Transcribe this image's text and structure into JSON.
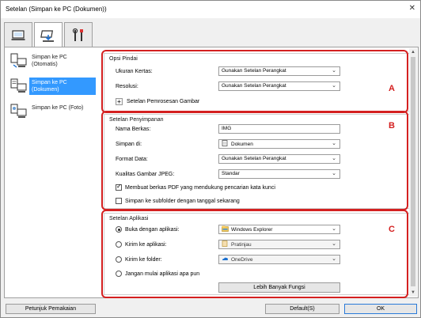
{
  "window": {
    "title": "Setelan (Simpan ke PC (Dokumen))",
    "close_glyph": "✕"
  },
  "tabs": [
    {
      "icon": "scan-to-pc-icon",
      "active": false
    },
    {
      "icon": "scanner-icon",
      "active": true
    },
    {
      "icon": "tools-icon",
      "active": false
    }
  ],
  "sidebar": {
    "items": [
      {
        "label": "Simpan ke PC (Otomatis)",
        "icon": "pc-auto-icon",
        "selected": false
      },
      {
        "label": "Simpan ke PC (Dokumen)",
        "icon": "pc-document-icon",
        "selected": true
      },
      {
        "label": "Simpan ke PC (Foto)",
        "icon": "pc-photo-icon",
        "selected": false
      }
    ]
  },
  "scan_options": {
    "header": "Opsi Pindai",
    "paper_size_label": "Ukuran Kertas:",
    "paper_size_value": "Gunakan Setelan Perangkat",
    "resolution_label": "Resolusi:",
    "resolution_value": "Gunakan Setelan Perangkat",
    "image_processing_label": "Setelan Pemrosesan Gambar",
    "marker": "A"
  },
  "save_settings": {
    "header": "Setelan Penyimpanan",
    "file_name_label": "Nama Berkas:",
    "file_name_value": "IMG",
    "save_in_label": "Simpan di:",
    "save_in_value": "Dokumen",
    "data_format_label": "Format Data:",
    "data_format_value": "Gunakan Setelan Perangkat",
    "jpeg_quality_label": "Kualitas Gambar JPEG:",
    "jpeg_quality_value": "Standar",
    "pdf_keyword_label": "Membuat berkas PDF yang mendukung pencarian kata kunci",
    "pdf_keyword_checked": true,
    "subfolder_label": "Simpan ke subfolder dengan tanggal sekarang",
    "subfolder_checked": false,
    "marker": "B"
  },
  "app_settings": {
    "header": "Setelan Aplikasi",
    "open_with_label": "Buka dengan aplikasi:",
    "open_with_value": "Windows Explorer",
    "send_to_app_label": "Kirim ke aplikasi:",
    "send_to_app_value": "Pratinjau",
    "send_to_folder_label": "Kirim ke folder:",
    "send_to_folder_value": "OneDrive",
    "do_not_start_label": "Jangan mulai aplikasi apa pun",
    "selected_option": "open_with",
    "more_functions_label": "Lebih Banyak Fungsi",
    "marker": "C"
  },
  "footer": {
    "instructions_label": "Petunjuk Pemakaian",
    "defaults_label": "Default(S)",
    "ok_label": "OK"
  },
  "colors": {
    "accent": "#3399ff",
    "marker_red": "#d42020"
  }
}
